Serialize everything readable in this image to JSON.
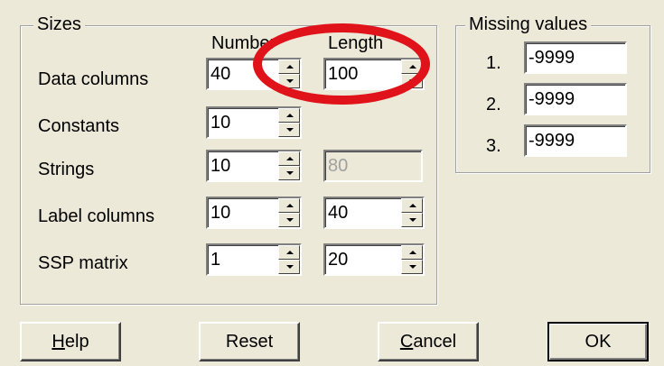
{
  "sizes": {
    "title": "Sizes",
    "col_number": "Number",
    "col_length": "Length",
    "rows": [
      {
        "label": "Data columns",
        "number": "40",
        "length": "100"
      },
      {
        "label": "Constants",
        "number": "10"
      },
      {
        "label": "Strings",
        "number": "10",
        "length": "80"
      },
      {
        "label": "Label columns",
        "number": "10",
        "length": "40"
      },
      {
        "label": "SSP matrix",
        "number": "1",
        "length": "20"
      }
    ]
  },
  "missing": {
    "title": "Missing values",
    "items": [
      {
        "index": "1.",
        "value": "-9999"
      },
      {
        "index": "2.",
        "value": "-9999"
      },
      {
        "index": "3.",
        "value": "-9999"
      }
    ]
  },
  "buttons": {
    "help_mnemonic": "H",
    "help_rest": "elp",
    "reset": "Reset",
    "cancel_mnemonic": "C",
    "cancel_rest": "ancel",
    "ok": "OK"
  },
  "annotation": {
    "color": "#E0131B"
  }
}
